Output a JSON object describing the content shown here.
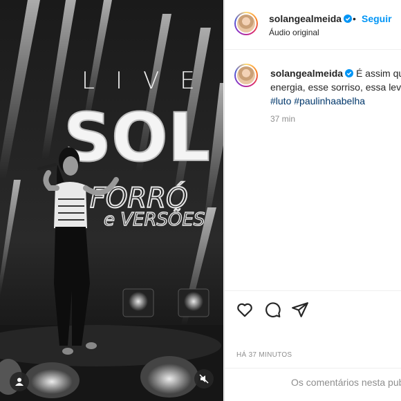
{
  "post": {
    "username": "solangealmeida",
    "follow_label": "Seguir",
    "separator": "•",
    "audio_label": "Áudio original",
    "caption_text": "É assim que",
    "caption_line2": "energia, esse sorriso, essa levez",
    "hashtags": [
      "#luto",
      "#paulinhaabelha"
    ],
    "time_ago": "37 min",
    "posted_date": "HÁ 37 MINUTOS",
    "comment_placeholder": "Os comentários nesta pub"
  },
  "media": {
    "live_text": "LIVE",
    "sol_text": "SOL",
    "forro_text": "FORRÓ",
    "versoes_text": "e VERSÕES"
  },
  "icons": {
    "verified": "verified-badge-icon",
    "user_tag": "user-tag-icon",
    "mute": "speaker-muted-icon",
    "like": "heart-icon",
    "comment": "comment-bubble-icon",
    "share": "paper-plane-icon"
  },
  "colors": {
    "accent": "#0095f6",
    "text": "#262626",
    "muted": "#8e8e8e",
    "hashtag": "#00376b"
  }
}
